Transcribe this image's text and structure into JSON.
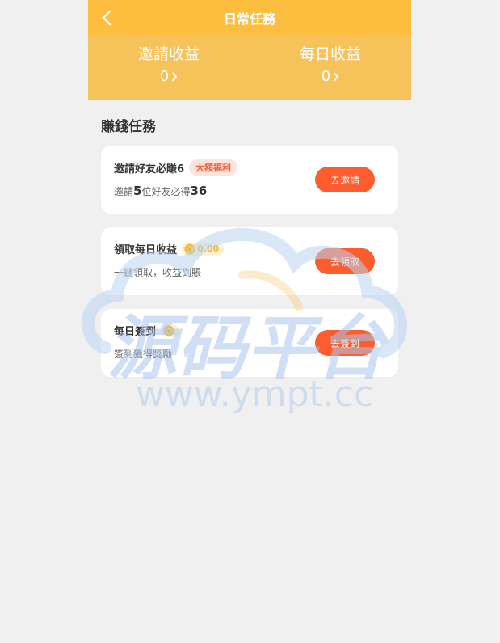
{
  "header": {
    "title": "日常任務"
  },
  "stats": [
    {
      "label": "邀請收益",
      "value": "0"
    },
    {
      "label": "每日收益",
      "value": "0"
    }
  ],
  "section_title": "賺錢任務",
  "tasks": [
    {
      "title": "邀請好友必賺6",
      "badge": "大額福利",
      "sub_prefix": "邀請",
      "sub_num1": "5",
      "sub_mid": "位好友必得",
      "sub_num2": "36",
      "button": "去邀請"
    },
    {
      "title": "領取每日收益",
      "coin_value": "0.00",
      "sub": "一鍵領取，收益到賬",
      "button": "去領取"
    },
    {
      "title": "每日簽到",
      "sub": "簽到獲得獎勵",
      "button": "去簽到"
    }
  ],
  "watermark": {
    "text": "源码平台",
    "url": "www.ympt.cc"
  },
  "colors": {
    "header": "#fdbe3f",
    "stats_bg": "#f6c25a",
    "button": "#fb5d2f",
    "badge_text": "#f0623a"
  }
}
